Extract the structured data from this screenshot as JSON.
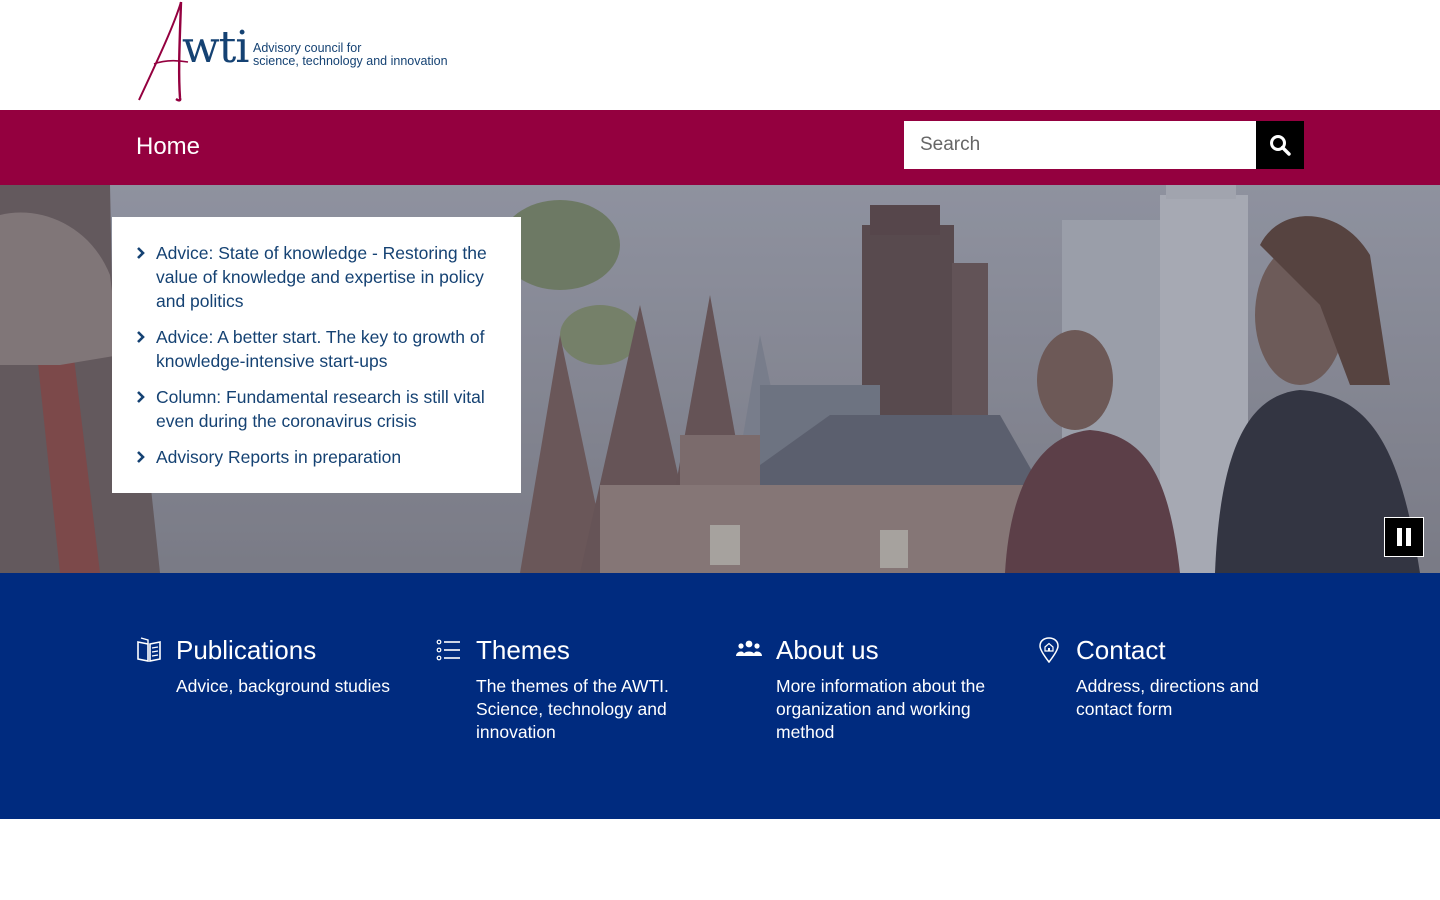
{
  "logo": {
    "wordmark": "AWTI",
    "tagline_line1": "Advisory council for",
    "tagline_line2": "science, technology and innovation"
  },
  "nav": {
    "home_label": "Home"
  },
  "search": {
    "placeholder": "Search",
    "icon": "search-icon"
  },
  "news": [
    {
      "label": "Advice: State of knowledge - Restoring the value of knowledge and expertise in policy and politics"
    },
    {
      "label": "Advice: A better start. The key to growth of knowledge-intensive start-ups"
    },
    {
      "label": "Column: Fundamental research is still vital even during the coronavirus crisis"
    },
    {
      "label": "Advisory Reports in preparation"
    }
  ],
  "slideshow": {
    "pause_icon": "pause-icon"
  },
  "tiles": [
    {
      "title": "Publications",
      "description": "Advice, background studies",
      "icon": "book-icon"
    },
    {
      "title": "Themes",
      "description": "The themes of the AWTI. Science, technology and innovation",
      "icon": "list-icon"
    },
    {
      "title": "About us",
      "description": "More information about the organization and working method",
      "icon": "people-icon"
    },
    {
      "title": "Contact",
      "description": "Address, directions and contact form",
      "icon": "location-pin-icon"
    }
  ],
  "colors": {
    "brand_red": "#94003f",
    "brand_blue": "#002b7f",
    "link_blue": "#154273"
  }
}
